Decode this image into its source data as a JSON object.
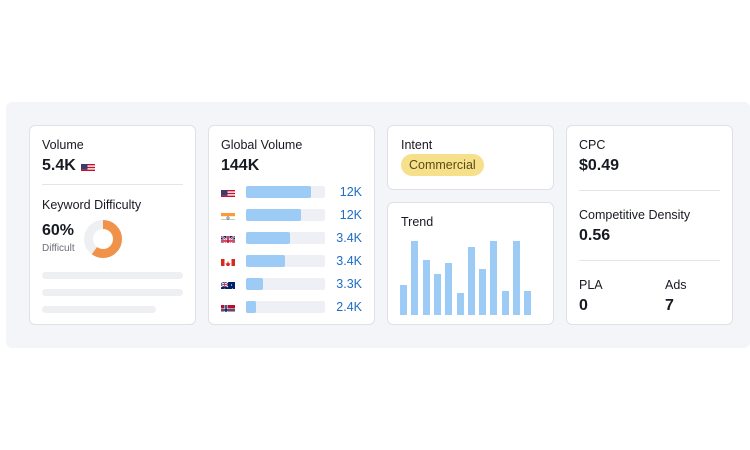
{
  "volume": {
    "label": "Volume",
    "value": "5.4K",
    "flag_icon": "us-flag-icon"
  },
  "keyword_difficulty": {
    "label": "Keyword Difficulty",
    "value": "60%",
    "level": "Difficult",
    "percent": 60,
    "color": "#f0924a"
  },
  "global_volume": {
    "label": "Global Volume",
    "value": "144K",
    "countries": [
      {
        "flag": "us-flag-icon",
        "value": "12K",
        "fill_pct": 82
      },
      {
        "flag": "in-flag-icon",
        "value": "12K",
        "fill_pct": 70
      },
      {
        "flag": "gb-flag-icon",
        "value": "3.4K",
        "fill_pct": 56
      },
      {
        "flag": "ca-flag-icon",
        "value": "3.4K",
        "fill_pct": 49
      },
      {
        "flag": "au-flag-icon",
        "value": "3.3K",
        "fill_pct": 21
      },
      {
        "flag": "no-flag-icon",
        "value": "2.4K",
        "fill_pct": 13
      }
    ],
    "value_color": "#1f6dc7"
  },
  "intent": {
    "label": "Intent",
    "badge": "Commercial",
    "badge_color": "#f7e08b"
  },
  "trend": {
    "label": "Trend",
    "chart_data": {
      "type": "bar",
      "values": [
        40,
        100,
        75,
        55,
        70,
        30,
        92,
        62,
        100,
        32,
        100,
        32
      ],
      "ylim": [
        0,
        100
      ],
      "color": "#9ccbf5"
    }
  },
  "cpc": {
    "label": "CPC",
    "value": "$0.49"
  },
  "competitive_density": {
    "label": "Competitive Density",
    "value": "0.56"
  },
  "pla": {
    "label": "PLA",
    "value": "0"
  },
  "ads": {
    "label": "Ads",
    "value": "7"
  }
}
